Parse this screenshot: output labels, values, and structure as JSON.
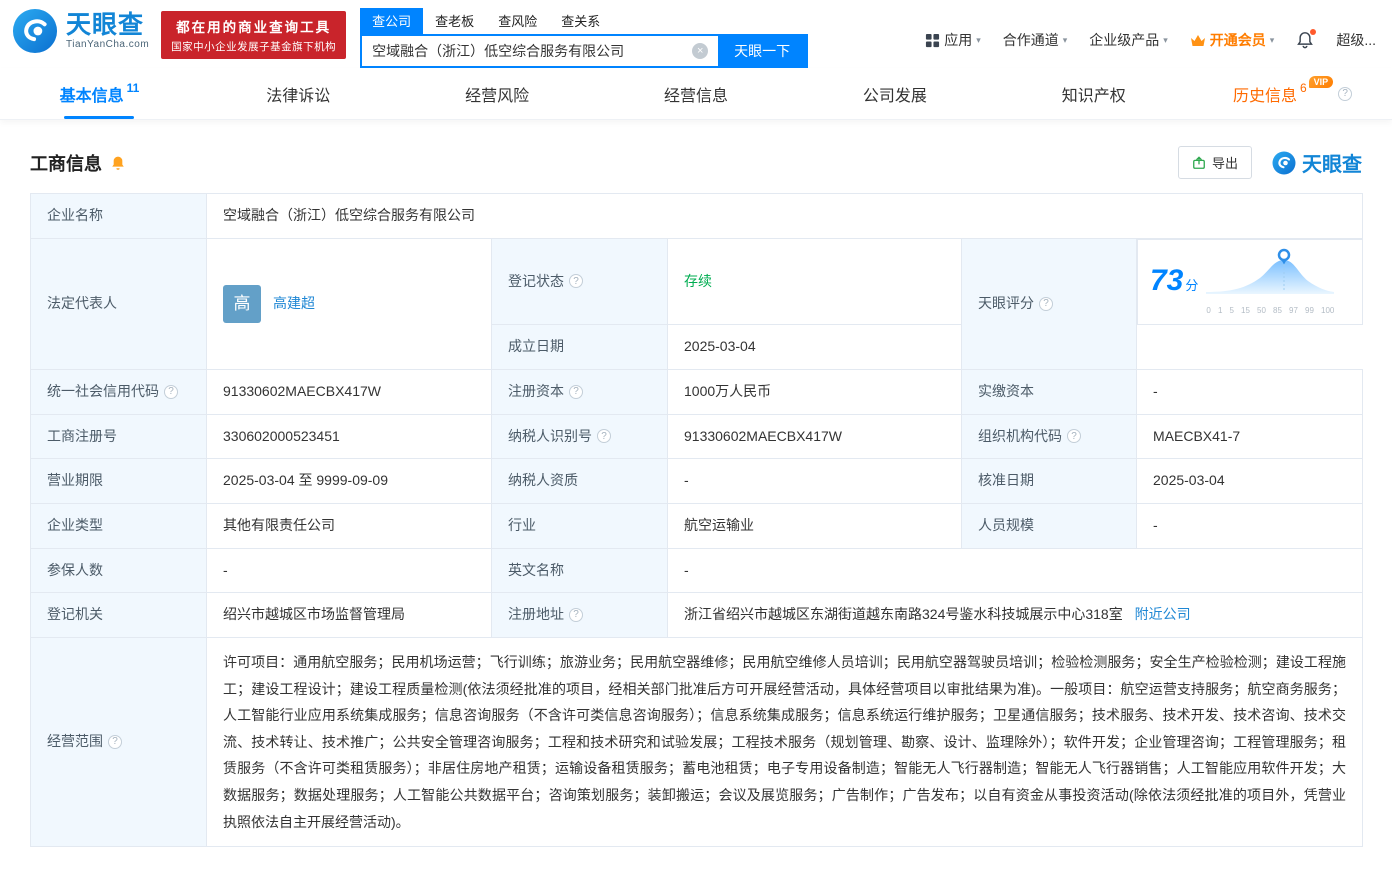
{
  "brand": {
    "name": "天眼查",
    "domain": "TianYanCha.com",
    "badge_line1": "都在用的商业查询工具",
    "badge_line2": "国家中小企业发展子基金旗下机构"
  },
  "search": {
    "tabs": [
      {
        "label": "查公司"
      },
      {
        "label": "查老板"
      },
      {
        "label": "查风险"
      },
      {
        "label": "查关系"
      }
    ],
    "value": "空域融合（浙江）低空综合服务有限公司",
    "button_label": "天眼一下"
  },
  "top_nav": {
    "apps": "应用",
    "cooperation": "合作通道",
    "enterprise": "企业级产品",
    "vip": "开通会员",
    "super": "超级..."
  },
  "page_tabs": [
    {
      "label": "基本信息",
      "count": "11"
    },
    {
      "label": "法律诉讼",
      "count": ""
    },
    {
      "label": "经营风险",
      "count": ""
    },
    {
      "label": "经营信息",
      "count": ""
    },
    {
      "label": "公司发展",
      "count": ""
    },
    {
      "label": "知识产权",
      "count": ""
    },
    {
      "label": "历史信息",
      "count": "6",
      "vip_badge": "VIP"
    }
  ],
  "section": {
    "title": "工商信息",
    "export_label": "导出",
    "watermark": "天眼查"
  },
  "table": {
    "company_name": {
      "label": "企业名称",
      "value": "空域融合（浙江）低空综合服务有限公司"
    },
    "legal_rep": {
      "label": "法定代表人",
      "avatar_text": "高",
      "name": "高建超"
    },
    "reg_status": {
      "label": "登记状态",
      "value": "存续"
    },
    "establish_date": {
      "label": "成立日期",
      "value": "2025-03-04"
    },
    "score": {
      "label": "天眼评分",
      "value": "73",
      "unit": "分",
      "ticks": [
        "0",
        "1",
        "5",
        "15",
        "50",
        "85",
        "97",
        "99",
        "100"
      ]
    },
    "credit_code": {
      "label": "统一社会信用代码",
      "value": "91330602MAECBX417W"
    },
    "reg_capital": {
      "label": "注册资本",
      "value": "1000万人民币"
    },
    "paid_capital": {
      "label": "实缴资本",
      "value": "-"
    },
    "reg_number": {
      "label": "工商注册号",
      "value": "330602000523451"
    },
    "taxpayer_id": {
      "label": "纳税人识别号",
      "value": "91330602MAECBX417W"
    },
    "org_code": {
      "label": "组织机构代码",
      "value": "MAECBX41-7"
    },
    "business_term": {
      "label": "营业期限",
      "value": "2025-03-04 至 9999-09-09"
    },
    "taxpayer_quality": {
      "label": "纳税人资质",
      "value": "-"
    },
    "approval_date": {
      "label": "核准日期",
      "value": "2025-03-04"
    },
    "company_type": {
      "label": "企业类型",
      "value": "其他有限责任公司"
    },
    "industry": {
      "label": "行业",
      "value": "航空运输业"
    },
    "staff_size": {
      "label": "人员规模",
      "value": "-"
    },
    "insured_count": {
      "label": "参保人数",
      "value": "-"
    },
    "english_name": {
      "label": "英文名称",
      "value": "-"
    },
    "reg_authority": {
      "label": "登记机关",
      "value": "绍兴市越城区市场监督管理局"
    },
    "reg_address": {
      "label": "注册地址",
      "value": "浙江省绍兴市越城区东湖街道越东南路324号鉴水科技城展示中心318室",
      "link_label": "附近公司"
    },
    "business_scope": {
      "label": "经营范围",
      "value": "许可项目：通用航空服务；民用机场运营；飞行训练；旅游业务；民用航空器维修；民用航空维修人员培训；民用航空器驾驶员培训；检验检测服务；安全生产检验检测；建设工程施工；建设工程设计；建设工程质量检测(依法须经批准的项目，经相关部门批准后方可开展经营活动，具体经营项目以审批结果为准)。一般项目：航空运营支持服务；航空商务服务；人工智能行业应用系统集成服务；信息咨询服务（不含许可类信息咨询服务）；信息系统集成服务；信息系统运行维护服务；卫星通信服务；技术服务、技术开发、技术咨询、技术交流、技术转让、技术推广；公共安全管理咨询服务；工程和技术研究和试验发展；工程技术服务（规划管理、勘察、设计、监理除外）；软件开发；企业管理咨询；工程管理服务；租赁服务（不含许可类租赁服务）；非居住房地产租赁；运输设备租赁服务；蓄电池租赁；电子专用设备制造；智能无人飞行器制造；智能无人飞行器销售；人工智能应用软件开发；大数据服务；数据处理服务；人工智能公共数据平台；咨询策划服务；装卸搬运；会议及展览服务；广告制作；广告发布；以自有资金从事投资活动(除依法须经批准的项目外，凭营业执照依法自主开展经营活动)。"
    }
  },
  "colors": {
    "brand_blue": "#0084ff",
    "badge_red": "#c9242b",
    "vip_orange": "#ff7d00",
    "status_green": "#00ad51",
    "link_blue": "#1f87d4",
    "label_bg": "#f1f8fe"
  }
}
